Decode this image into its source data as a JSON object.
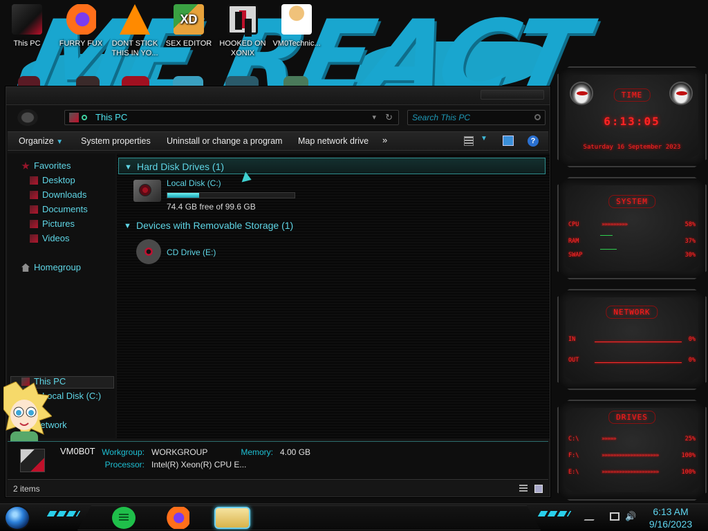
{
  "desktop": {
    "wallpaper_text": "ME REACT",
    "icons": [
      {
        "label": "This PC",
        "icon": "pc-icon"
      },
      {
        "label": "FURRY FUX",
        "icon": "firefox-icon"
      },
      {
        "label": "DONT STICK THIS IN YO...",
        "icon": "vlc-icon"
      },
      {
        "label": "SEX EDITOR",
        "icon": "hxd-icon"
      },
      {
        "label": "HOOKED ON XONIX",
        "icon": "xonix-icon"
      },
      {
        "label": "VM0Technic...",
        "icon": "user-icon"
      }
    ]
  },
  "explorer": {
    "address": "This PC",
    "search_placeholder": "Search This PC",
    "commands": [
      "Organize",
      "System properties",
      "Uninstall or change a program",
      "Map network drive",
      "»"
    ],
    "nav": {
      "favorites": "Favorites",
      "favorites_items": [
        "Desktop",
        "Downloads",
        "Documents",
        "Pictures",
        "Videos"
      ],
      "homegroup": "Homegroup",
      "this_pc": "This PC",
      "local_disk": "Local Disk (C:)",
      "network": "Network"
    },
    "groups": [
      {
        "title": "Hard Disk Drives (1)"
      },
      {
        "title": "Devices with Removable Storage (1)"
      }
    ],
    "drives": {
      "local": {
        "name": "Local Disk (C:)",
        "free_text": "74.4 GB free of 99.6 GB",
        "used_fraction": 0.25
      },
      "cd": {
        "name": "CD Drive (E:)"
      }
    },
    "details": {
      "computer_name": "VM0B0T",
      "workgroup_label": "Workgroup:",
      "workgroup_value": "WORKGROUP",
      "memory_label": "Memory:",
      "memory_value": "4.00 GB",
      "processor_label": "Processor:",
      "processor_value": "Intel(R) Xeon(R) CPU E..."
    },
    "status": "2 items"
  },
  "gadgets": {
    "time": {
      "title": "TIME",
      "time": "6:13:05",
      "date": "Saturday 16 September 2023"
    },
    "system": {
      "title": "SYSTEM",
      "rows": [
        {
          "label": "CPU",
          "arrows": "»»»»»»»»»",
          "pct": "58%"
        },
        {
          "label": "RAM",
          "arrows": "",
          "pct": "37%"
        },
        {
          "label": "SWAP",
          "arrows": "",
          "pct": "30%"
        }
      ]
    },
    "network": {
      "title": "NETWORK",
      "rows": [
        {
          "label": "IN",
          "pct": "0%"
        },
        {
          "label": "OUT",
          "pct": "0%"
        }
      ]
    },
    "drives": {
      "title": "DRIVES",
      "rows": [
        {
          "label": "C:\\",
          "arrows": "»»»»»",
          "pct": "25%"
        },
        {
          "label": "F:\\",
          "arrows": "»»»»»»»»»»»»»»»»»»»»",
          "pct": "100%"
        },
        {
          "label": "E:\\",
          "arrows": "»»»»»»»»»»»»»»»»»»»»",
          "pct": "100%"
        }
      ]
    }
  },
  "taskbar": {
    "apps": [
      "notes-app",
      "firefox",
      "file-explorer"
    ],
    "clock_time": "6:13 AM",
    "clock_date": "9/16/2023"
  },
  "colors": {
    "accent_cyan": "#5fd6e6",
    "gadget_red": "#ff2424",
    "bar_fill": "#1aa3b5"
  }
}
